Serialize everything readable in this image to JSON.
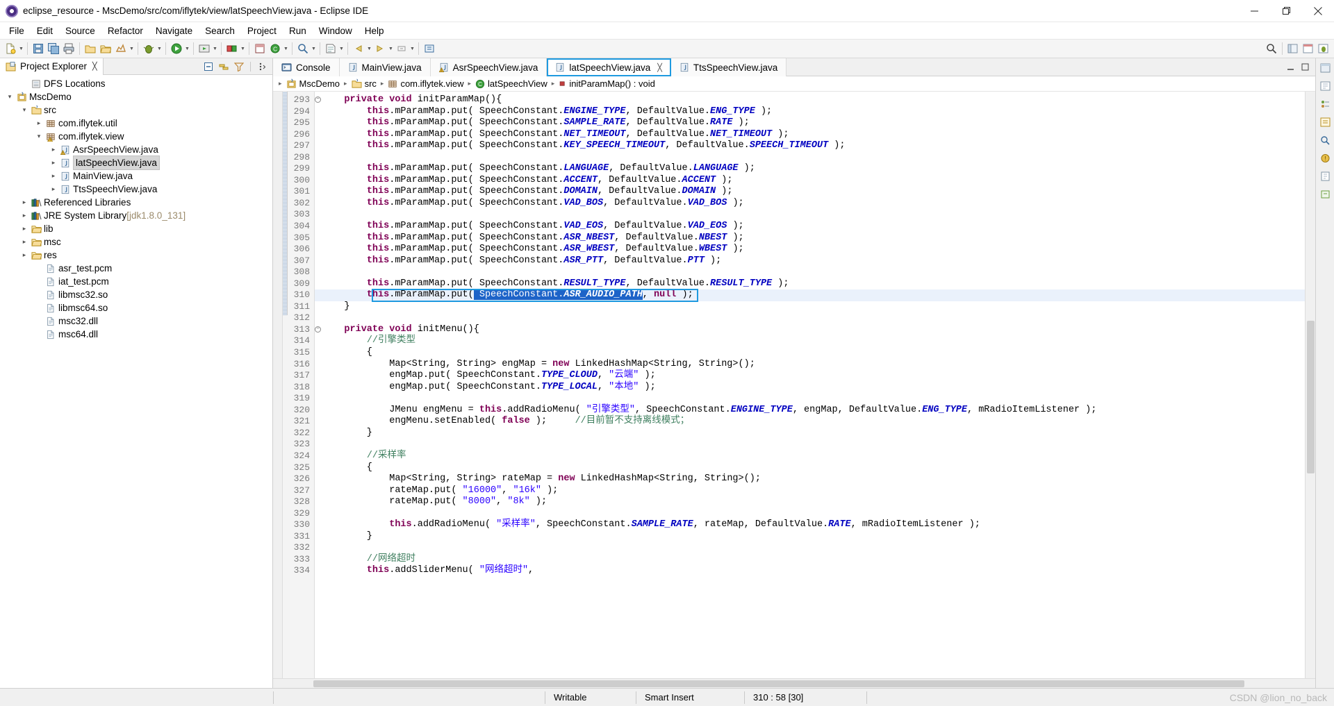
{
  "window": {
    "title": "eclipse_resource - MscDemo/src/com/iflytek/view/latSpeechView.java - Eclipse IDE",
    "app_icon": "eclipse-icon",
    "minimize": "minimize-icon",
    "maximize": "restore-icon",
    "close": "close-icon"
  },
  "menubar": {
    "items": [
      {
        "label": "File"
      },
      {
        "label": "Edit"
      },
      {
        "label": "Source"
      },
      {
        "label": "Refactor"
      },
      {
        "label": "Navigate"
      },
      {
        "label": "Search"
      },
      {
        "label": "Project"
      },
      {
        "label": "Run"
      },
      {
        "label": "Window"
      },
      {
        "label": "Help"
      }
    ]
  },
  "toolbar": {
    "groups": [
      [
        "new-icon",
        "caret",
        "save-icon",
        "save-all-icon",
        "print-icon"
      ],
      [
        "new-folder-icon",
        "open-folder-icon",
        "quick-access-icon",
        "caret"
      ],
      [
        "debug-icon",
        "caret",
        "run-icon",
        "caret",
        "run-external-icon",
        "caret"
      ],
      [
        "coverage-icon",
        "caret",
        "new-java-project-icon",
        "new-class-icon",
        "caret"
      ],
      [
        "search-icon",
        "caret",
        "open-type-icon",
        "caret"
      ],
      [
        "back-icon",
        "caret",
        "forward-icon",
        "caret",
        "next-annotation-icon",
        "caret"
      ],
      [
        "link-icon"
      ]
    ],
    "right": [
      "search-icon",
      "perspective-java-icon",
      "perspective-debug-icon",
      "open-perspective-icon"
    ]
  },
  "sidebar": {
    "view_title": "Project Explorer",
    "close_label": "╳",
    "actions": [
      "collapse-all-icon",
      "link-with-editor-icon",
      "view-filter-icon",
      "view-menu-icon"
    ],
    "tree": [
      {
        "label": "DFS Locations",
        "icon": "dfs-locations-icon",
        "depth": 1,
        "arrow": "none",
        "selected": false
      },
      {
        "label": "MscDemo",
        "icon": "java-project-icon",
        "depth": 0,
        "arrow": "down",
        "selected": false
      },
      {
        "label": "src",
        "icon": "source-folder-icon",
        "depth": 1,
        "arrow": "down",
        "selected": false
      },
      {
        "label": "com.iflytek.util",
        "icon": "package-icon",
        "depth": 2,
        "arrow": "right",
        "selected": false
      },
      {
        "label": "com.iflytek.view",
        "icon": "package-warning-icon",
        "depth": 2,
        "arrow": "down",
        "selected": false
      },
      {
        "label": "AsrSpeechView.java",
        "icon": "java-file-warning-icon",
        "depth": 3,
        "arrow": "right",
        "selected": false
      },
      {
        "label": "latSpeechView.java",
        "icon": "java-file-icon",
        "depth": 3,
        "arrow": "right",
        "selected": true
      },
      {
        "label": "MainView.java",
        "icon": "java-file-icon",
        "depth": 3,
        "arrow": "right",
        "selected": false
      },
      {
        "label": "TtsSpeechView.java",
        "icon": "java-file-icon",
        "depth": 3,
        "arrow": "right",
        "selected": false
      },
      {
        "label": "Referenced Libraries",
        "icon": "library-icon",
        "depth": 1,
        "arrow": "right",
        "selected": false
      },
      {
        "label": "JRE System Library",
        "sublabel": "[jdk1.8.0_131]",
        "icon": "library-icon",
        "depth": 1,
        "arrow": "right",
        "selected": false
      },
      {
        "label": "lib",
        "icon": "folder-icon",
        "depth": 1,
        "arrow": "right",
        "selected": false
      },
      {
        "label": "msc",
        "icon": "folder-icon",
        "depth": 1,
        "arrow": "right",
        "selected": false
      },
      {
        "label": "res",
        "icon": "folder-icon",
        "depth": 1,
        "arrow": "right",
        "selected": false
      },
      {
        "label": "asr_test.pcm",
        "icon": "file-icon",
        "depth": 2,
        "arrow": "none",
        "selected": false
      },
      {
        "label": "iat_test.pcm",
        "icon": "file-icon",
        "depth": 2,
        "arrow": "none",
        "selected": false
      },
      {
        "label": "libmsc32.so",
        "icon": "file-icon",
        "depth": 2,
        "arrow": "none",
        "selected": false
      },
      {
        "label": "libmsc64.so",
        "icon": "file-icon",
        "depth": 2,
        "arrow": "none",
        "selected": false
      },
      {
        "label": "msc32.dll",
        "icon": "file-icon",
        "depth": 2,
        "arrow": "none",
        "selected": false
      },
      {
        "label": "msc64.dll",
        "icon": "file-icon",
        "depth": 2,
        "arrow": "none",
        "selected": false
      }
    ]
  },
  "editor": {
    "tabs": [
      {
        "label": "Console",
        "icon": "console-icon",
        "active": false,
        "closable": false,
        "highlighted": false
      },
      {
        "label": "MainView.java",
        "icon": "java-file-icon",
        "active": false,
        "closable": false,
        "highlighted": false
      },
      {
        "label": "AsrSpeechView.java",
        "icon": "java-file-warning-icon",
        "active": false,
        "closable": false,
        "highlighted": false
      },
      {
        "label": "latSpeechView.java",
        "icon": "java-file-icon",
        "active": true,
        "closable": true,
        "highlighted": true
      },
      {
        "label": "TtsSpeechView.java",
        "icon": "java-file-icon",
        "active": false,
        "closable": false,
        "highlighted": false
      }
    ],
    "tab_close_glyph": "╳",
    "breadcrumb": [
      {
        "label": "MscDemo",
        "icon": "java-project-icon"
      },
      {
        "label": "src",
        "icon": "source-folder-icon"
      },
      {
        "label": "com.iflytek.view",
        "icon": "package-icon"
      },
      {
        "label": "latSpeechView",
        "icon": "class-icon"
      },
      {
        "label": "initParamMap() : void",
        "icon": "method-icon"
      }
    ],
    "breadcrumb_separator": "▸",
    "first_line_number": 293,
    "selection_box_line": 310,
    "lines": [
      {
        "n": 293,
        "fold": true,
        "current": false,
        "html": "    <span class=\"kw\">private</span> <span class=\"kw\">void</span> initParamMap(){"
      },
      {
        "n": 294,
        "fold": false,
        "current": false,
        "html": "        <span class=\"kw\">this</span>.mParamMap.put( SpeechConstant.<span class=\"fld\">ENGINE_TYPE</span>, DefaultValue.<span class=\"fld\">ENG_TYPE</span> );"
      },
      {
        "n": 295,
        "fold": false,
        "current": false,
        "html": "        <span class=\"kw\">this</span>.mParamMap.put( SpeechConstant.<span class=\"fld\">SAMPLE_RATE</span>, DefaultValue.<span class=\"fld\">RATE</span> );"
      },
      {
        "n": 296,
        "fold": false,
        "current": false,
        "html": "        <span class=\"kw\">this</span>.mParamMap.put( SpeechConstant.<span class=\"fld\">NET_TIMEOUT</span>, DefaultValue.<span class=\"fld\">NET_TIMEOUT</span> );"
      },
      {
        "n": 297,
        "fold": false,
        "current": false,
        "html": "        <span class=\"kw\">this</span>.mParamMap.put( SpeechConstant.<span class=\"fld\">KEY_SPEECH_TIMEOUT</span>, DefaultValue.<span class=\"fld\">SPEECH_TIMEOUT</span> );"
      },
      {
        "n": 298,
        "fold": false,
        "current": false,
        "html": ""
      },
      {
        "n": 299,
        "fold": false,
        "current": false,
        "html": "        <span class=\"kw\">this</span>.mParamMap.put( SpeechConstant.<span class=\"fld\">LANGUAGE</span>, DefaultValue.<span class=\"fld\">LANGUAGE</span> );"
      },
      {
        "n": 300,
        "fold": false,
        "current": false,
        "html": "        <span class=\"kw\">this</span>.mParamMap.put( SpeechConstant.<span class=\"fld\">ACCENT</span>, DefaultValue.<span class=\"fld\">ACCENT</span> );"
      },
      {
        "n": 301,
        "fold": false,
        "current": false,
        "html": "        <span class=\"kw\">this</span>.mParamMap.put( SpeechConstant.<span class=\"fld\">DOMAIN</span>, DefaultValue.<span class=\"fld\">DOMAIN</span> );"
      },
      {
        "n": 302,
        "fold": false,
        "current": false,
        "html": "        <span class=\"kw\">this</span>.mParamMap.put( SpeechConstant.<span class=\"fld\">VAD_BOS</span>, DefaultValue.<span class=\"fld\">VAD_BOS</span> );"
      },
      {
        "n": 303,
        "fold": false,
        "current": false,
        "html": ""
      },
      {
        "n": 304,
        "fold": false,
        "current": false,
        "html": "        <span class=\"kw\">this</span>.mParamMap.put( SpeechConstant.<span class=\"fld\">VAD_EOS</span>, DefaultValue.<span class=\"fld\">VAD_EOS</span> );"
      },
      {
        "n": 305,
        "fold": false,
        "current": false,
        "html": "        <span class=\"kw\">this</span>.mParamMap.put( SpeechConstant.<span class=\"fld\">ASR_NBEST</span>, DefaultValue.<span class=\"fld\">NBEST</span> );"
      },
      {
        "n": 306,
        "fold": false,
        "current": false,
        "html": "        <span class=\"kw\">this</span>.mParamMap.put( SpeechConstant.<span class=\"fld\">ASR_WBEST</span>, DefaultValue.<span class=\"fld\">WBEST</span> );"
      },
      {
        "n": 307,
        "fold": false,
        "current": false,
        "html": "        <span class=\"kw\">this</span>.mParamMap.put( SpeechConstant.<span class=\"fld\">ASR_PTT</span>, DefaultValue.<span class=\"fld\">PTT</span> );"
      },
      {
        "n": 308,
        "fold": false,
        "current": false,
        "html": ""
      },
      {
        "n": 309,
        "fold": false,
        "current": false,
        "html": "        <span class=\"kw\">this</span>.mParamMap.put( SpeechConstant.<span class=\"fld\">RESULT_TYPE</span>, DefaultValue.<span class=\"fld\">RESULT_TYPE</span> );"
      },
      {
        "n": 310,
        "fold": false,
        "current": true,
        "html": "        <span class=\"kw\">this</span>.mParamMap.put(<span class=\"sel\"> SpeechConstant.<span class=\"fld\">ASR_AUDIO_PATH</span></span>, <span class=\"kw\">null</span> );"
      },
      {
        "n": 311,
        "fold": false,
        "current": false,
        "html": "    }"
      },
      {
        "n": 312,
        "fold": false,
        "current": false,
        "html": ""
      },
      {
        "n": 313,
        "fold": true,
        "current": false,
        "html": "    <span class=\"kw\">private</span> <span class=\"kw\">void</span> initMenu(){"
      },
      {
        "n": 314,
        "fold": false,
        "current": false,
        "html": "        <span class=\"cmt\">//引擎类型</span>"
      },
      {
        "n": 315,
        "fold": false,
        "current": false,
        "html": "        {"
      },
      {
        "n": 316,
        "fold": false,
        "current": false,
        "html": "            Map&lt;String, String&gt; engMap = <span class=\"kw\">new</span> LinkedHashMap&lt;String, String&gt;();"
      },
      {
        "n": 317,
        "fold": false,
        "current": false,
        "html": "            engMap.put( SpeechConstant.<span class=\"fld\">TYPE_CLOUD</span>, <span class=\"str\">\"云端\"</span> );"
      },
      {
        "n": 318,
        "fold": false,
        "current": false,
        "html": "            engMap.put( SpeechConstant.<span class=\"fld\">TYPE_LOCAL</span>, <span class=\"str\">\"本地\"</span> );"
      },
      {
        "n": 319,
        "fold": false,
        "current": false,
        "html": ""
      },
      {
        "n": 320,
        "fold": false,
        "current": false,
        "html": "            JMenu engMenu = <span class=\"kw\">this</span>.addRadioMenu( <span class=\"str\">\"引擎类型\"</span>, SpeechConstant.<span class=\"fld\">ENGINE_TYPE</span>, engMap, DefaultValue.<span class=\"fld\">ENG_TYPE</span>, mRadioItemListener );"
      },
      {
        "n": 321,
        "fold": false,
        "current": false,
        "html": "            engMenu.setEnabled( <span class=\"kw\">false</span> );     <span class=\"cmt\">//目前暂不支持离线模式；</span>"
      },
      {
        "n": 322,
        "fold": false,
        "current": false,
        "html": "        }"
      },
      {
        "n": 323,
        "fold": false,
        "current": false,
        "html": ""
      },
      {
        "n": 324,
        "fold": false,
        "current": false,
        "html": "        <span class=\"cmt\">//采样率</span>"
      },
      {
        "n": 325,
        "fold": false,
        "current": false,
        "html": "        {"
      },
      {
        "n": 326,
        "fold": false,
        "current": false,
        "html": "            Map&lt;String, String&gt; rateMap = <span class=\"kw\">new</span> LinkedHashMap&lt;String, String&gt;();"
      },
      {
        "n": 327,
        "fold": false,
        "current": false,
        "html": "            rateMap.put( <span class=\"str\">\"16000\"</span>, <span class=\"str\">\"16k\"</span> );"
      },
      {
        "n": 328,
        "fold": false,
        "current": false,
        "html": "            rateMap.put( <span class=\"str\">\"8000\"</span>, <span class=\"str\">\"8k\"</span> );"
      },
      {
        "n": 329,
        "fold": false,
        "current": false,
        "html": ""
      },
      {
        "n": 330,
        "fold": false,
        "current": false,
        "html": "            <span class=\"kw\">this</span>.addRadioMenu( <span class=\"str\">\"采样率\"</span>, SpeechConstant.<span class=\"fld\">SAMPLE_RATE</span>, rateMap, DefaultValue.<span class=\"fld\">RATE</span>, mRadioItemListener );"
      },
      {
        "n": 331,
        "fold": false,
        "current": false,
        "html": "        }"
      },
      {
        "n": 332,
        "fold": false,
        "current": false,
        "html": ""
      },
      {
        "n": 333,
        "fold": false,
        "current": false,
        "html": "        <span class=\"cmt\">//网络超时</span>"
      },
      {
        "n": 334,
        "fold": false,
        "current": false,
        "html": "        <span class=\"kw\">this</span>.addSliderMenu( <span class=\"str\">\"网络超时\"</span>,"
      }
    ]
  },
  "statusbar": {
    "writable": "Writable",
    "insert_mode": "Smart Insert",
    "position": "310 : 58 [30]",
    "watermark": "CSDN @lion_no_back"
  },
  "colors": {
    "accent_blue": "#1e9ae0",
    "selection_blue": "#1d63c8",
    "current_line": "#eaf1fb",
    "keyword": "#7f0055",
    "field": "#0000c0",
    "string": "#2a00ff",
    "comment": "#3f7f5f"
  }
}
